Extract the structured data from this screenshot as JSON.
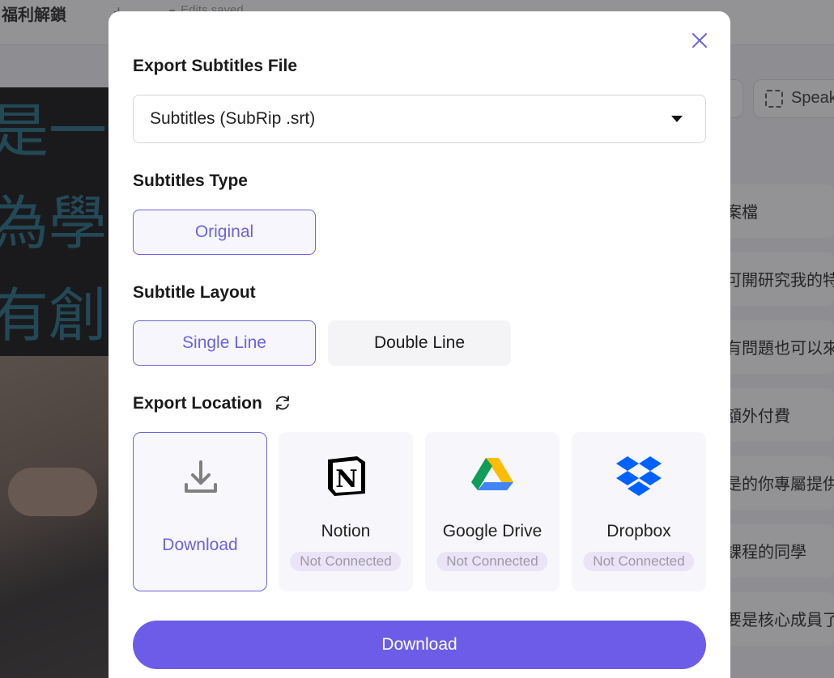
{
  "background": {
    "project_title": "福利解鎖",
    "plus_label": "+",
    "saved_label": "Edits saved",
    "speaker_label": "Speak",
    "video_captions": [
      "是一個",
      "為學習",
      "有創作"
    ],
    "transcript_rows": [
      "案檔",
      "可開研究我的特",
      "有問題也可以來",
      "額外付費",
      "是的你專屬提供",
      "課程的同學",
      "要是核心成員了"
    ]
  },
  "modal": {
    "title": "Export Subtitles File",
    "file_format": {
      "selected": "Subtitles (SubRip .srt)"
    },
    "subtitles_type": {
      "title": "Subtitles Type",
      "options": [
        {
          "label": "Original",
          "selected": true
        }
      ]
    },
    "subtitle_layout": {
      "title": "Subtitle Layout",
      "options": [
        {
          "label": "Single Line",
          "selected": true
        },
        {
          "label": "Double Line",
          "selected": false
        }
      ]
    },
    "export_location": {
      "title": "Export Location",
      "destinations": [
        {
          "name": "Download",
          "icon": "download-icon",
          "selected": true
        },
        {
          "name": "Notion",
          "icon": "notion-icon",
          "status": "Not Connected"
        },
        {
          "name": "Google Drive",
          "icon": "google-drive-icon",
          "status": "Not Connected"
        },
        {
          "name": "Dropbox",
          "icon": "dropbox-icon",
          "status": "Not Connected"
        }
      ]
    },
    "primary_button": "Download"
  },
  "colors": {
    "accent": "#6c5ce7",
    "accent_text": "#6c63e0",
    "badge_bg": "#ebe4f6"
  }
}
